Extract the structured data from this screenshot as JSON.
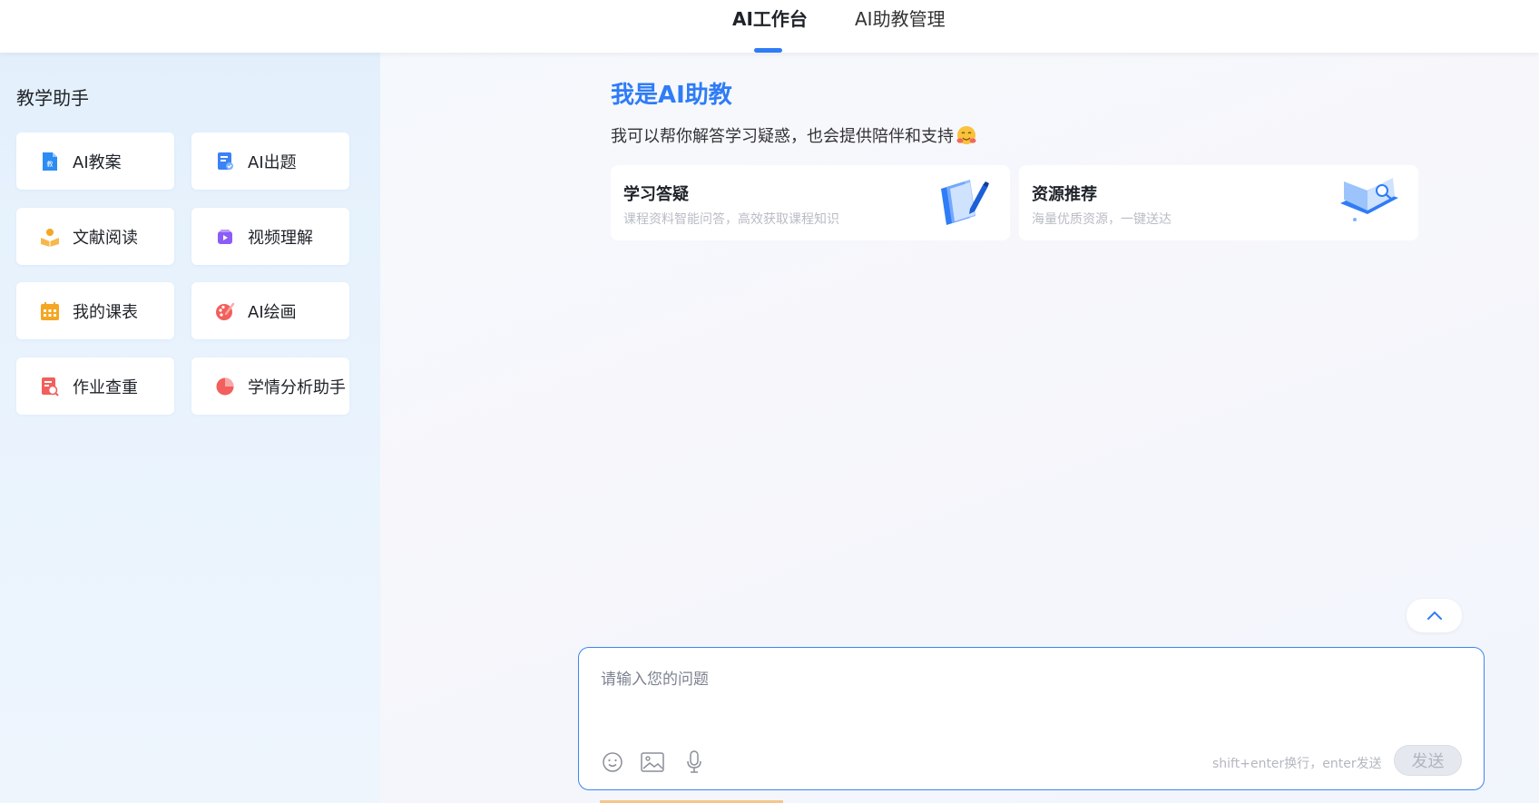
{
  "nav": {
    "tabs": [
      {
        "label": "AI工作台",
        "active": true
      },
      {
        "label": "AI助教管理",
        "active": false
      }
    ],
    "accent": "#2f7cf6"
  },
  "sidebar": {
    "title": "教学助手",
    "tools": [
      {
        "label": "AI教案",
        "icon": "document-icon",
        "color": "#2b8cf3"
      },
      {
        "label": "AI出题",
        "icon": "question-paper-icon",
        "color": "#3b82f6"
      },
      {
        "label": "文献阅读",
        "icon": "reader-icon",
        "color": "#f5a623"
      },
      {
        "label": "视频理解",
        "icon": "video-icon",
        "color": "#8b5cf6"
      },
      {
        "label": "我的课表",
        "icon": "calendar-icon",
        "color": "#f5a623"
      },
      {
        "label": "AI绘画",
        "icon": "palette-icon",
        "color": "#f25f5c"
      },
      {
        "label": "作业查重",
        "icon": "check-document-icon",
        "color": "#f25f5c"
      },
      {
        "label": "学情分析助手",
        "icon": "pie-chart-icon",
        "color": "#f25f5c"
      }
    ]
  },
  "main": {
    "hero_title": "我是AI助教",
    "hero_subtitle": "我可以帮你解答学习疑惑，也会提供陪伴和支持",
    "features": [
      {
        "title": "学习答疑",
        "desc": "课程资料智能问答，高效获取课程知识",
        "icon": "notebook-pen-icon"
      },
      {
        "title": "资源推荐",
        "desc": "海量优质资源，一键送达",
        "icon": "open-book-icon"
      }
    ]
  },
  "composer": {
    "placeholder": "请输入您的问题",
    "hint": "shift+enter换行，enter发送",
    "send_label": "发送",
    "icons": [
      "emoji-icon",
      "image-icon",
      "microphone-icon"
    ]
  }
}
